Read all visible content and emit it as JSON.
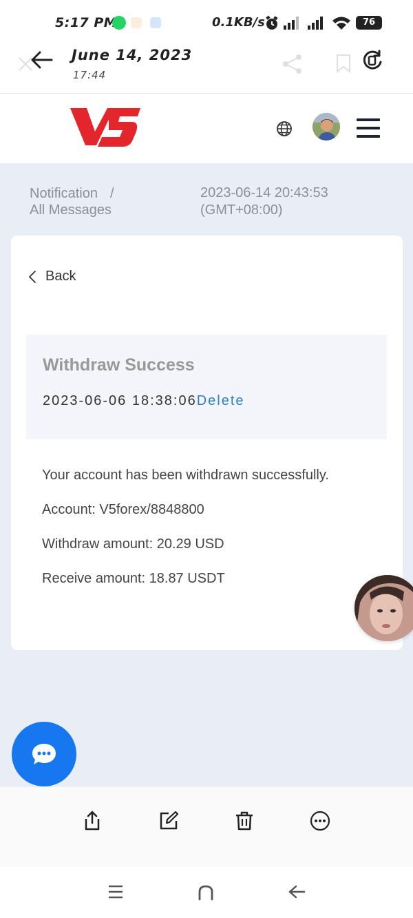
{
  "status_bar": {
    "time": "5:17 PM",
    "net_speed": "0.1KB/s",
    "battery": "76"
  },
  "browser": {
    "date": "June 14, 2023",
    "time": "17:44"
  },
  "site": {
    "brand": "V5"
  },
  "breadcrumb": {
    "parent": "Notification",
    "separator": "/",
    "current": "All Messages"
  },
  "sent_time": {
    "datetime": "2023-06-14 20:43:53",
    "timezone": "(GMT+08:00)"
  },
  "card": {
    "back_label": "Back",
    "title": "Withdraw Success",
    "date": "2023-06-06 18:38:06",
    "delete_label": "Delete",
    "body": [
      "Your account has been withdrawn successfully.",
      "Account: V5forex/8848800",
      "Withdraw amount: 20.29 USD",
      "Receive amount: 18.87 USDT"
    ]
  },
  "colors": {
    "brand_red": "#e3262b",
    "link_blue": "#2a7fc8",
    "fab_blue": "#1677ee",
    "page_bg": "#e9edf6"
  },
  "icons": {
    "toolbar": [
      "share-icon",
      "edit-icon",
      "trash-icon",
      "more-icon"
    ],
    "android_nav": [
      "recents-icon",
      "home-icon",
      "back-icon"
    ]
  }
}
